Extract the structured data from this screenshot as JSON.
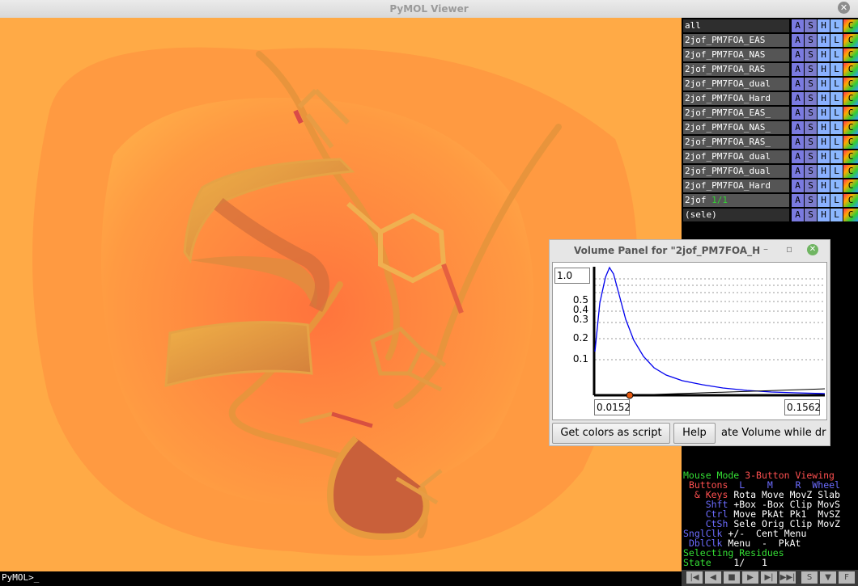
{
  "window": {
    "title": "PyMOL Viewer",
    "close_glyph": "✕"
  },
  "command_line": {
    "prompt": "PyMOL>_"
  },
  "objects": [
    {
      "name": "all",
      "state": ""
    },
    {
      "name": "2jof_PM7FOA_EAS",
      "state": ""
    },
    {
      "name": "2jof_PM7FOA_NAS",
      "state": ""
    },
    {
      "name": "2jof_PM7FOA_RAS",
      "state": ""
    },
    {
      "name": "2jof_PM7FOA_dual",
      "state": ""
    },
    {
      "name": "2jof_PM7FOA_Hard",
      "state": ""
    },
    {
      "name": "2jof_PM7FOA_EAS_",
      "state": ""
    },
    {
      "name": "2jof_PM7FOA_NAS_",
      "state": ""
    },
    {
      "name": "2jof_PM7FOA_RAS_",
      "state": ""
    },
    {
      "name": "2jof_PM7FOA_dual",
      "state": ""
    },
    {
      "name": "2jof_PM7FOA_dual",
      "state": ""
    },
    {
      "name": "2jof_PM7FOA_Hard",
      "state": ""
    },
    {
      "name": "2jof",
      "state": "1/1"
    },
    {
      "name": "(sele)",
      "state": ""
    }
  ],
  "object_buttons": {
    "a": "A",
    "s": "S",
    "h": "H",
    "l": "L",
    "c": "C"
  },
  "volume_panel": {
    "title": "Volume Panel for \"2jof_PM7FOA_H",
    "minimize_glyph": "–",
    "restore_glyph": "▫",
    "close_glyph": "✕",
    "ymax_value": "1.0",
    "xmin_value": "0.0152",
    "xmax_value": "0.1562",
    "y_ticks": [
      "0.5",
      "0.4",
      "0.3",
      "0.2",
      "0.1"
    ],
    "get_colors_button": "Get colors as script",
    "help_button": "Help",
    "update_checkbox_text": "ate Volume while dr"
  },
  "mouse_mode": {
    "line1": {
      "label": "Mouse Mode",
      "value": "3-Button Viewing"
    },
    "line2": {
      "buttons": "Buttons",
      "l": "L",
      "m": "M",
      "r": "R",
      "wheel": "Wheel"
    },
    "rows": [
      {
        "key": "& Keys",
        "a": "Rota",
        "b": "Move",
        "c": "MovZ",
        "d": "Slab"
      },
      {
        "key": "Shft",
        "a": "+Box",
        "b": "-Box",
        "c": "Clip",
        "d": "MovS"
      },
      {
        "key": "Ctrl",
        "a": "Move",
        "b": "PkAt",
        "c": "Pk1",
        "d": "MvSZ"
      },
      {
        "key": "CtSh",
        "a": "Sele",
        "b": "Orig",
        "c": "Clip",
        "d": "MovZ"
      }
    ],
    "sngl": {
      "key": "SnglClk",
      "a": "+/-",
      "b": "Cent",
      "c": "Menu"
    },
    "dbl": {
      "key": "DblClk",
      "a": "Menu",
      "b": "-",
      "c": "PkAt"
    },
    "selecting": "Selecting Residues",
    "state_label": "State",
    "state_value": "1/",
    "state_total": "1"
  },
  "vcr": {
    "first": "|◀",
    "back": "◀",
    "stop": "■",
    "play": "▶",
    "fwd": "▶|",
    "last": "▶▶|",
    "s": "S",
    "down": "▼",
    "f": "F"
  },
  "colors": {
    "viewport_bg": "#ffa744",
    "orange_inner": "#ff8640",
    "cartoon": "#e8a040"
  }
}
